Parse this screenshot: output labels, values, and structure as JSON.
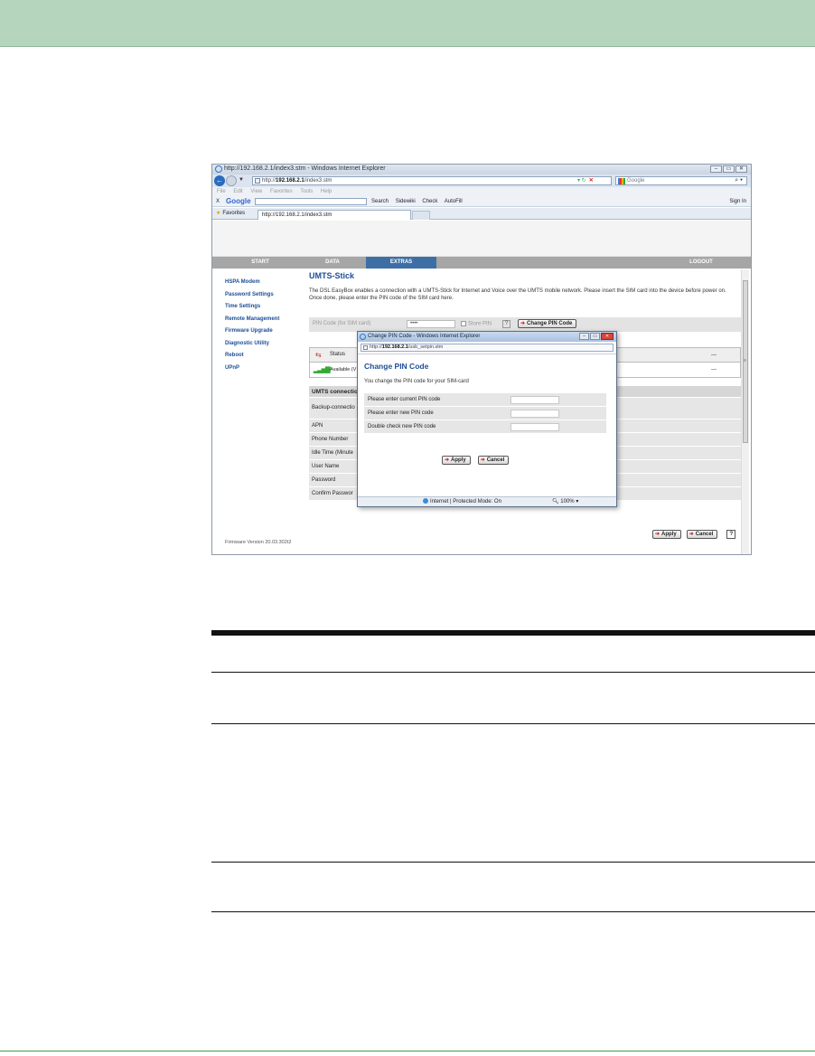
{
  "browser": {
    "title": "http://192.168.2.1/index3.stm - Windows Internet Explorer",
    "url_prefix": "http://",
    "url_host": "192.168.2.1",
    "url_path": "/index3.stm",
    "search_placeholder": "Google",
    "menu": [
      "File",
      "Edit",
      "View",
      "Favorites",
      "Tools",
      "Help"
    ],
    "google_bar": {
      "close": "X",
      "logo": "Google",
      "tools": [
        "Search",
        "Sidewiki",
        "Check",
        "AutoFill"
      ],
      "signin": "Sign In"
    },
    "favorites_label": "Favorites",
    "tab_label": "http://192.168.2.1/index3.stm"
  },
  "router": {
    "nav": [
      "START",
      "DATA",
      "EXTRAS",
      "LOGOUT"
    ],
    "sidebar": [
      "HSPA Modem",
      "Password Settings",
      "Time Settings",
      "Remote Management",
      "Firmware Upgrade",
      "Diagnostic Utility",
      "Reboot",
      "UPnP"
    ],
    "firmware": "Firmware Version 20.03.302t2",
    "title": "UMTS-Stick",
    "description": "The DSL EasyBox enables a connection with a UMTS-Stick for Internet and Voice over the UMTS mobile network. Please insert the SIM card into the device before power on. Once done, please enter the PIN code of the SIM card here.",
    "pin_label": "PIN Code (for SIM card)",
    "pin_value": "••••",
    "store_pin": "Store PIN",
    "help": "?",
    "change_pin_button": "Change PIN Code",
    "status_header": "Status",
    "status_value": "Available (V",
    "status_dash1": "---",
    "status_dash2": "---",
    "umts_rows": [
      "UMTS connectio",
      "Backup-connectio",
      "APN",
      "Phone Number",
      "Idle Time (Minute",
      "User Name",
      "Password",
      "Confirm Passwor"
    ],
    "apply": "Apply",
    "cancel": "Cancel"
  },
  "popup": {
    "title": "Change PIN Code - Windows Internet Explorer",
    "url_prefix": "http://",
    "url_host": "192.168.2.1",
    "url_path": "/usb_setpin.stm",
    "heading": "Change PIN Code",
    "description": "You change the PIN code for your SIM-card",
    "fields": [
      "Please enter current PIN code",
      "Please enter new PIN code",
      "Double check new PIN code"
    ],
    "apply": "Apply",
    "cancel": "Cancel",
    "status_text": "Internet | Protected Mode: On",
    "zoom": "100%"
  }
}
